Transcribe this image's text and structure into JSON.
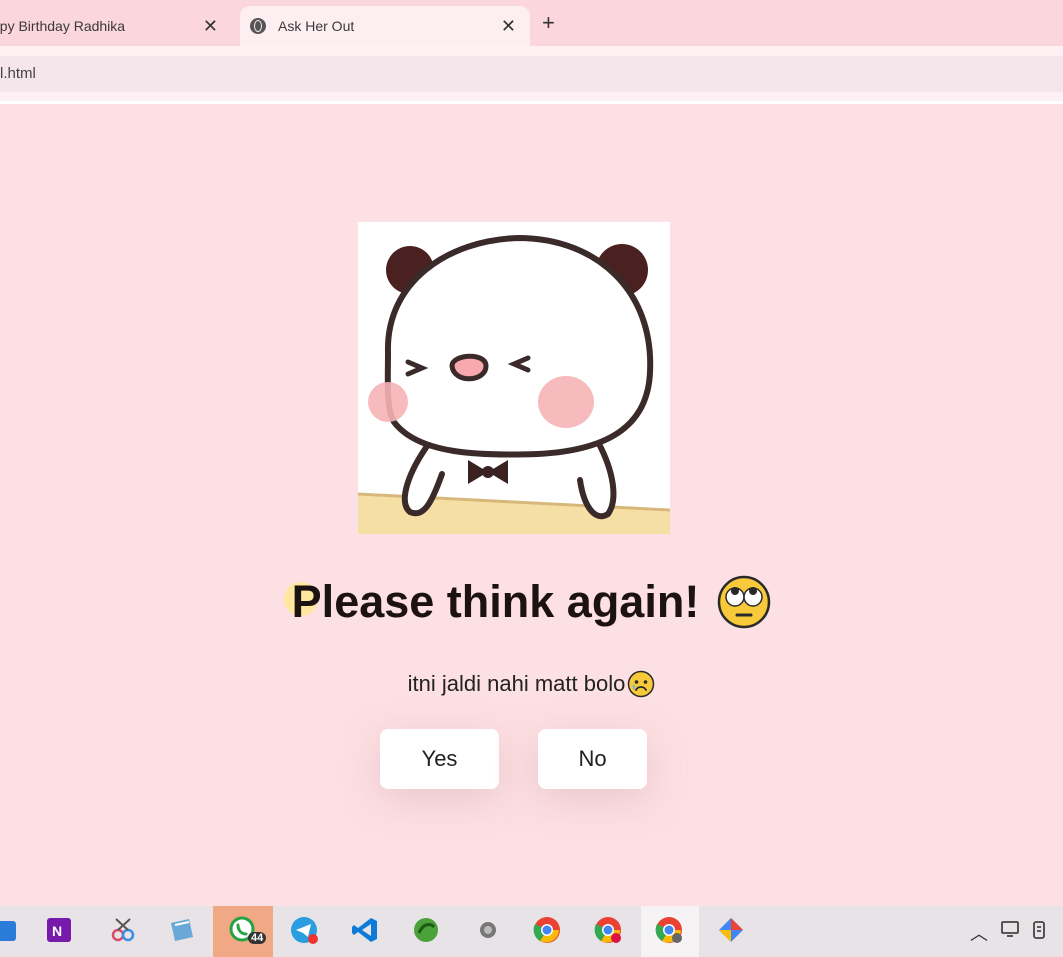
{
  "browser": {
    "tabs": [
      {
        "label": "ppy Birthday Radhika",
        "close": "✕",
        "active": false
      },
      {
        "label": "Ask Her Out",
        "close": "✕",
        "active": true
      }
    ],
    "new_tab": "+",
    "url": "l.html"
  },
  "page": {
    "image": "panda-sticker",
    "heading": "Please think again!",
    "heading_emoji": "face-with-rolling-eyes",
    "subtitle": "itni jaldi nahi matt bolo",
    "subtitle_emoji": "sad-face",
    "yes_label": "Yes",
    "no_label": "No"
  },
  "taskbar": {
    "apps": [
      "file-explorer-icon",
      "onenote-icon",
      "snipping-tool-icon",
      "notepad-icon",
      "whatsapp-icon",
      "telegram-icon",
      "vscode-icon",
      "app-icon",
      "settings-icon",
      "chrome-icon",
      "chrome-profile-icon",
      "chrome-profile-2-icon",
      "app-colorful-icon"
    ],
    "whatsapp_badge": "44",
    "tray": [
      "chevron-up-icon",
      "display-icon",
      "battery-icon"
    ]
  },
  "colors": {
    "page_bg": "#fde0e3",
    "tabbar_bg": "#fbd6dc",
    "heading": "#1d1212"
  }
}
